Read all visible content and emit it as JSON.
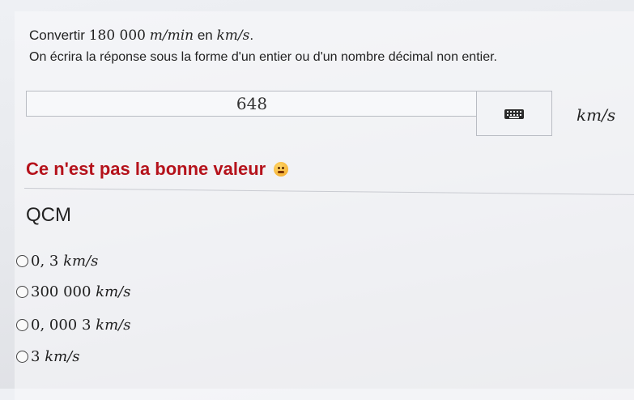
{
  "question": {
    "prefix": "Convertir ",
    "value": "180 000",
    "unit_from": "m/min",
    "middle": " en ",
    "unit_to": "km/s",
    "suffix": "."
  },
  "instruction": "On écrira la réponse sous la forme d'un entier ou d'un nombre décimal non entier.",
  "answer": {
    "value": "648",
    "unit": "km/s"
  },
  "feedback": "Ce n'est pas la bonne valeur",
  "qcm": {
    "title": "QCM",
    "options": [
      {
        "number": "0, 3",
        "unit": "km/s"
      },
      {
        "number": "300 000",
        "unit": "km/s"
      },
      {
        "number": "0, 000 3",
        "unit": "km/s"
      },
      {
        "number": "3",
        "unit": "km/s"
      }
    ]
  },
  "icons": {
    "keyboard": "keyboard-icon",
    "feedback": "disappointed-face-icon"
  }
}
